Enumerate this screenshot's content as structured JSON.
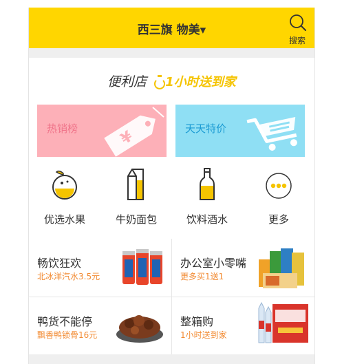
{
  "header": {
    "location": "西三旗 物美▾",
    "search_label": "搜索"
  },
  "store": {
    "name": "便利店",
    "slogan": "1小时送到家",
    "banners": [
      {
        "label": "热销榜",
        "icon": "price-tag-icon"
      },
      {
        "label": "天天特价",
        "icon": "shopping-cart-icon"
      }
    ],
    "categories": [
      {
        "label": "优选水果",
        "icon": "orange-icon"
      },
      {
        "label": "牛奶面包",
        "icon": "milk-carton-icon"
      },
      {
        "label": "饮料酒水",
        "icon": "soda-bottle-icon"
      },
      {
        "label": "更多",
        "icon": "more-dots-icon"
      }
    ]
  },
  "promos": [
    {
      "title": "畅饮狂欢",
      "subtitle": "北冰洋汽水3.5元",
      "image": "soda-cans-image"
    },
    {
      "title": "办公室小零嘴",
      "subtitle": "更多买1送1",
      "image": "snack-bags-image"
    },
    {
      "title": "鸭货不能停",
      "subtitle": "飘香鸭锁骨16元",
      "image": "duck-neck-plate-image"
    },
    {
      "title": "整箱购",
      "subtitle": "1小时送到家",
      "image": "water-case-image"
    }
  ],
  "colors": {
    "header_bg": "#ffd600",
    "hot_banner_bg": "#fdb0b8",
    "deal_banner_bg": "#8fdff4",
    "accent_orange": "#f28b33"
  }
}
